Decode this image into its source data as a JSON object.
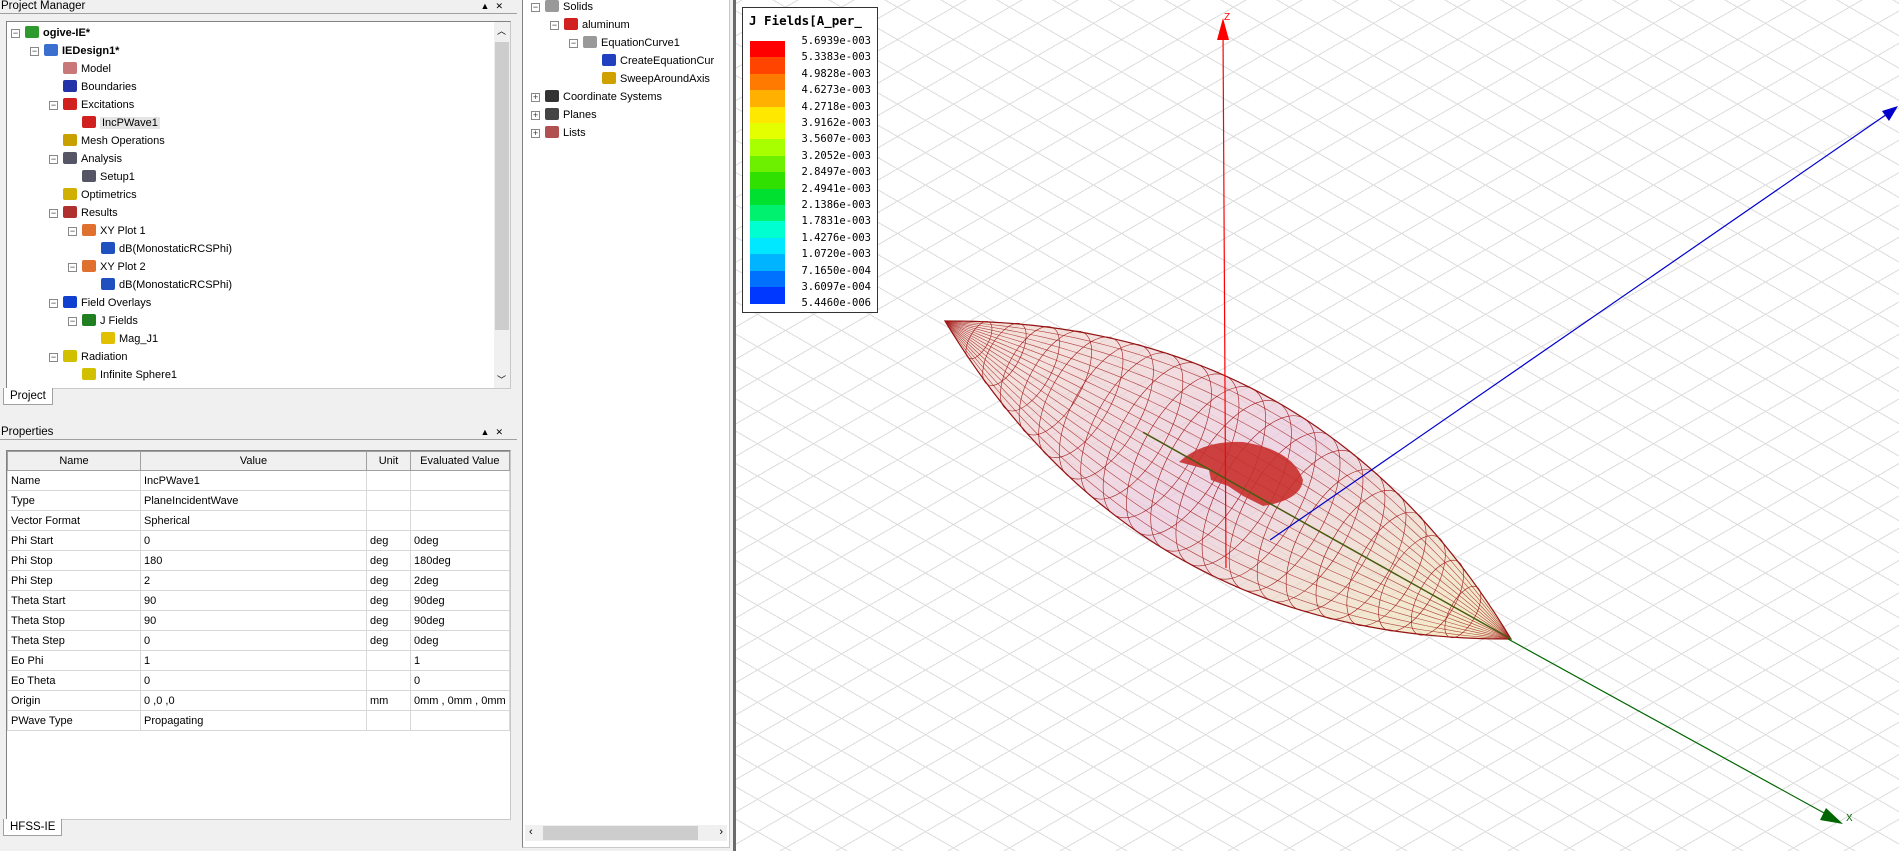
{
  "project_manager": {
    "title": "Project Manager",
    "tab": "Project",
    "tree": [
      {
        "label": "ogive-IE*",
        "level": 0,
        "bold": true,
        "exp": "-",
        "icon": "project-icon",
        "color": "#2e9a2e"
      },
      {
        "label": "IEDesign1*",
        "level": 1,
        "bold": true,
        "exp": "-",
        "icon": "design-icon",
        "color": "#3a6fd0"
      },
      {
        "label": "Model",
        "level": 2,
        "icon": "model-icon",
        "color": "#c87878"
      },
      {
        "label": "Boundaries",
        "level": 2,
        "icon": "boundaries-icon",
        "color": "#2233aa"
      },
      {
        "label": "Excitations",
        "level": 2,
        "exp": "-",
        "icon": "excitations-icon",
        "color": "#d02020"
      },
      {
        "label": "IncPWave1",
        "level": 3,
        "icon": "excitation-icon",
        "color": "#d02020",
        "selected": true
      },
      {
        "label": "Mesh Operations",
        "level": 2,
        "icon": "mesh-icon",
        "color": "#c8a000"
      },
      {
        "label": "Analysis",
        "level": 2,
        "exp": "-",
        "icon": "analysis-icon",
        "color": "#556"
      },
      {
        "label": "Setup1",
        "level": 3,
        "icon": "setup-icon",
        "color": "#556"
      },
      {
        "label": "Optimetrics",
        "level": 2,
        "icon": "optimetrics-icon",
        "color": "#d0b000"
      },
      {
        "label": "Results",
        "level": 2,
        "exp": "-",
        "icon": "results-icon",
        "color": "#b03030"
      },
      {
        "label": "XY Plot 1",
        "level": 3,
        "exp": "-",
        "icon": "xy-plot-icon",
        "color": "#e07030"
      },
      {
        "label": "dB(MonostaticRCSPhi)",
        "level": 4,
        "icon": "trace-icon",
        "color": "#2050c0"
      },
      {
        "label": "XY Plot 2",
        "level": 3,
        "exp": "-",
        "icon": "xy-plot-icon",
        "color": "#e07030"
      },
      {
        "label": "dB(MonostaticRCSPhi)",
        "level": 4,
        "icon": "trace-icon",
        "color": "#2050c0"
      },
      {
        "label": "Field Overlays",
        "level": 2,
        "exp": "-",
        "icon": "field-overlays-icon",
        "color": "#1040d0"
      },
      {
        "label": "J Fields",
        "level": 3,
        "exp": "-",
        "icon": "j-fields-icon",
        "color": "#208020"
      },
      {
        "label": "Mag_J1",
        "level": 4,
        "icon": "mag-plot-icon",
        "color": "#e0c000"
      },
      {
        "label": "Radiation",
        "level": 2,
        "exp": "-",
        "icon": "radiation-icon",
        "color": "#d0c000"
      },
      {
        "label": "Infinite Sphere1",
        "level": 3,
        "icon": "infinite-sphere-icon",
        "color": "#d0c000"
      }
    ]
  },
  "properties": {
    "title": "Properties",
    "tab": "HFSS-IE",
    "columns": [
      "Name",
      "Value",
      "Unit",
      "Evaluated Value"
    ],
    "rows": [
      [
        "Name",
        "IncPWave1",
        "",
        ""
      ],
      [
        "Type",
        "PlaneIncidentWave",
        "",
        ""
      ],
      [
        "Vector Format",
        "Spherical",
        "",
        ""
      ],
      [
        "Phi Start",
        "0",
        "deg",
        "0deg"
      ],
      [
        "Phi Stop",
        "180",
        "deg",
        "180deg"
      ],
      [
        "Phi Step",
        "2",
        "deg",
        "2deg"
      ],
      [
        "Theta Start",
        "90",
        "deg",
        "90deg"
      ],
      [
        "Theta Stop",
        "90",
        "deg",
        "90deg"
      ],
      [
        "Theta Step",
        "0",
        "deg",
        "0deg"
      ],
      [
        "Eo Phi",
        "1",
        "",
        "1"
      ],
      [
        "Eo Theta",
        "0",
        "",
        "0"
      ],
      [
        "Origin",
        "0 ,0 ,0",
        "mm",
        "0mm , 0mm , 0mm"
      ],
      [
        "PWave Type",
        "Propagating",
        "",
        ""
      ]
    ]
  },
  "model_tree": [
    {
      "label": "Solids",
      "level": 0,
      "exp": "-",
      "icon": "solids-icon",
      "color": "#999"
    },
    {
      "label": "aluminum",
      "level": 1,
      "exp": "-",
      "icon": "material-icon",
      "color": "#d02020"
    },
    {
      "label": "EquationCurve1",
      "level": 2,
      "exp": "-",
      "icon": "object-icon",
      "color": "#999"
    },
    {
      "label": "CreateEquationCur",
      "level": 3,
      "icon": "create-equation-curve-icon",
      "color": "#2040c0"
    },
    {
      "label": "SweepAroundAxis",
      "level": 3,
      "icon": "sweep-icon",
      "color": "#d0a000"
    },
    {
      "label": "Coordinate Systems",
      "level": 0,
      "exp": "+",
      "icon": "coordinate-systems-icon",
      "color": "#333"
    },
    {
      "label": "Planes",
      "level": 0,
      "exp": "+",
      "icon": "planes-icon",
      "color": "#444"
    },
    {
      "label": "Lists",
      "level": 0,
      "exp": "+",
      "icon": "lists-icon",
      "color": "#b05050"
    }
  ],
  "legend": {
    "title": "J Fields[A_per_",
    "values": [
      "5.6939e-003",
      "5.3383e-003",
      "4.9828e-003",
      "4.6273e-003",
      "4.2718e-003",
      "3.9162e-003",
      "3.5607e-003",
      "3.2052e-003",
      "2.8497e-003",
      "2.4941e-003",
      "2.1386e-003",
      "1.7831e-003",
      "1.4276e-003",
      "1.0720e-003",
      "7.1650e-004",
      "3.6097e-004",
      "5.4460e-006"
    ],
    "colors": [
      "#ff0000",
      "#ff4400",
      "#ff7a00",
      "#ffb000",
      "#ffe800",
      "#e4ff00",
      "#a8ff00",
      "#6cf000",
      "#30e000",
      "#00e030",
      "#00f070",
      "#00ffd0",
      "#00e8ff",
      "#00b4ff",
      "#0070ff",
      "#0038ff",
      "#0000ff"
    ]
  },
  "axes": {
    "z": "Z",
    "x": "X",
    "colors": {
      "z": "#ff0000",
      "y": "#0000cc",
      "x": "#006600"
    }
  }
}
